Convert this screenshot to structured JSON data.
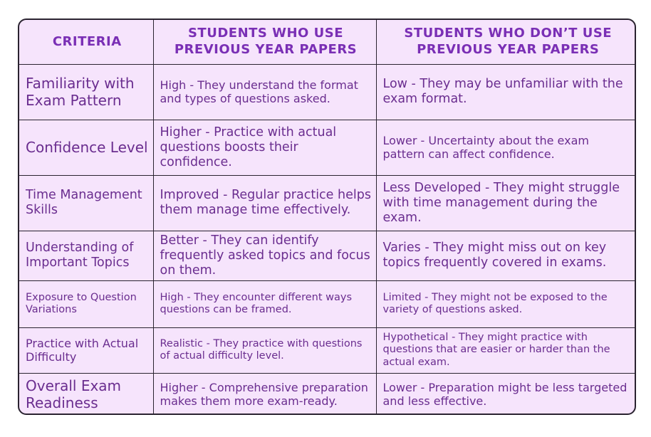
{
  "headers": [
    "Criteria",
    "Students Who Use Previous Year Papers",
    "Students Who Don’t Use Previous Year Papers"
  ],
  "rows": [
    {
      "criteria": "Familiarity with Exam Pattern",
      "use": "High - They understand the format and types of questions asked.",
      "dont": "Low - They may be unfamiliar with the exam format."
    },
    {
      "criteria": "Confidence Level",
      "use": "Higher - Practice with actual questions boosts their confidence.",
      "dont": "Lower - Uncertainty about the exam pattern can affect confidence."
    },
    {
      "criteria": "Time Management Skills",
      "use": "Improved - Regular practice helps them manage time effectively.",
      "dont": "Less Developed - They might struggle with time management during the exam."
    },
    {
      "criteria": "Understanding of Important Topics",
      "use": "Better - They can identify frequently asked topics and focus on them.",
      "dont": "Varies - They might miss out on key topics frequently covered in exams."
    },
    {
      "criteria": "Exposure to Question Variations",
      "use": "High - They encounter different ways questions can be framed.",
      "dont": "Limited - They might not be exposed to the variety of questions asked."
    },
    {
      "criteria": "Practice with Actual Difficulty",
      "use": "Realistic - They practice with questions of actual difficulty level.",
      "dont": "Hypothetical - They might practice with questions that are easier or harder than the actual exam."
    },
    {
      "criteria": "Overall Exam Readiness",
      "use": "Higher - Comprehensive preparation makes them more exam-ready.",
      "dont": "Lower - Preparation might be less targeted and less effective."
    }
  ]
}
